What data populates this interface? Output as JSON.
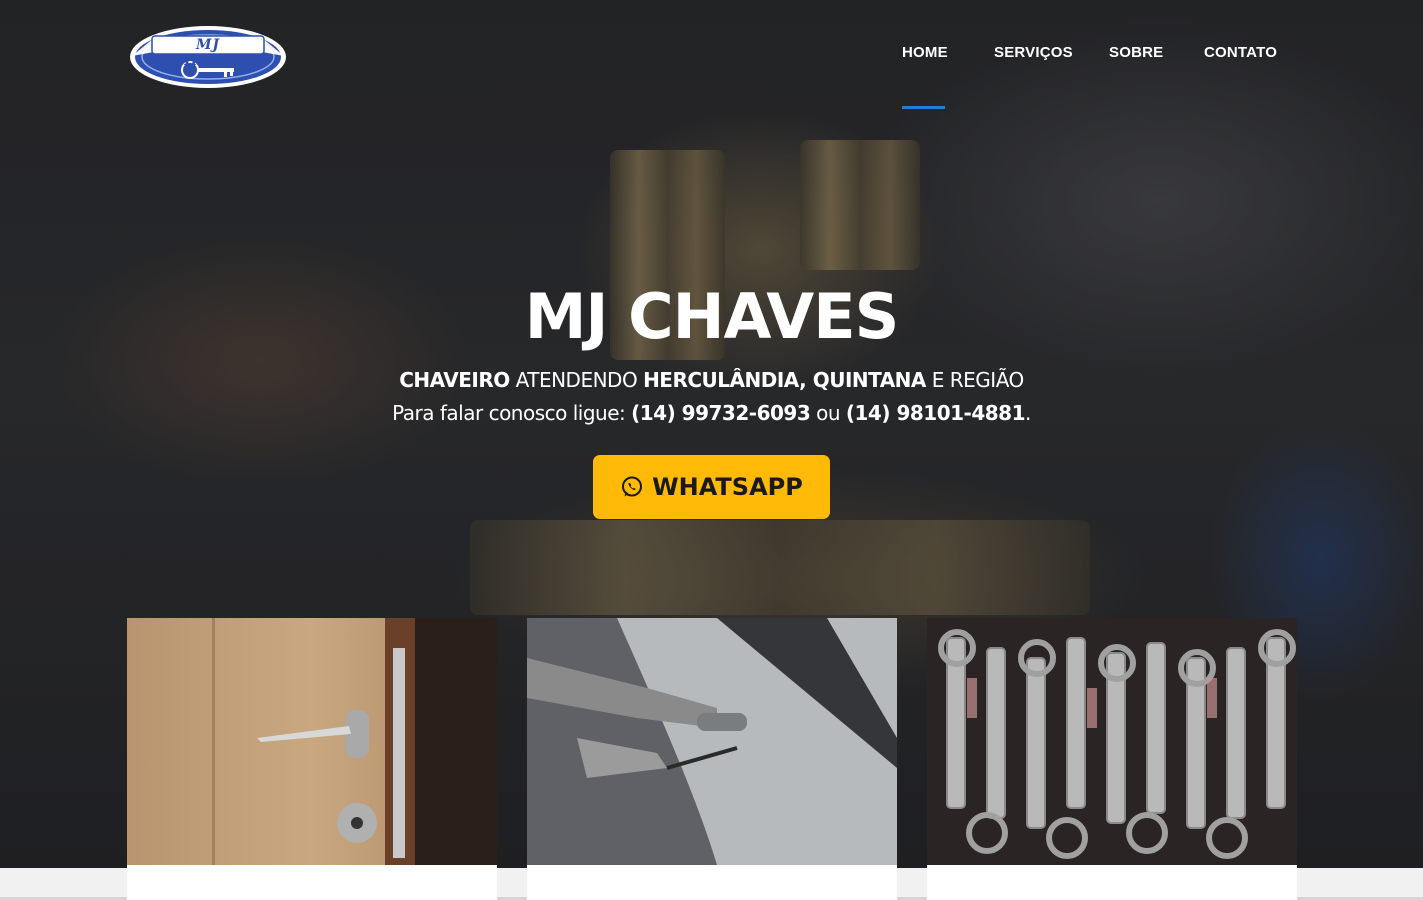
{
  "brand": {
    "logo_text": "MJ CHAVES",
    "logo_colors": {
      "primary": "#2e4fb0",
      "light": "#8fb2ee",
      "outline": "#ffffff"
    }
  },
  "nav": {
    "items": [
      {
        "label": "HOME",
        "active": true
      },
      {
        "label": "SERVIÇOS",
        "active": false
      },
      {
        "label": "SOBRE",
        "active": false
      },
      {
        "label": "CONTATO",
        "active": false
      }
    ],
    "active_color": "#1f7de0"
  },
  "hero": {
    "title": "MJ CHAVES",
    "line1": {
      "part1_bold": "CHAVEIRO",
      "part2": " ATENDENDO ",
      "part3_bold": "HERCULÂNDIA, QUINTANA",
      "part4": " E REGIÃO"
    },
    "line2": {
      "prefix": "Para falar conosco ligue: ",
      "phone1": "(14) 99732-6093",
      "middle": " ou ",
      "phone2": "(14) 98101-4881",
      "suffix": "."
    },
    "cta": {
      "label": "WHATSAPP",
      "icon": "whatsapp-icon",
      "color": "#ffba08"
    }
  },
  "cards": [
    {
      "image": "door-lock-handle"
    },
    {
      "image": "car-door-unlocking"
    },
    {
      "image": "key-blanks-rack"
    }
  ]
}
